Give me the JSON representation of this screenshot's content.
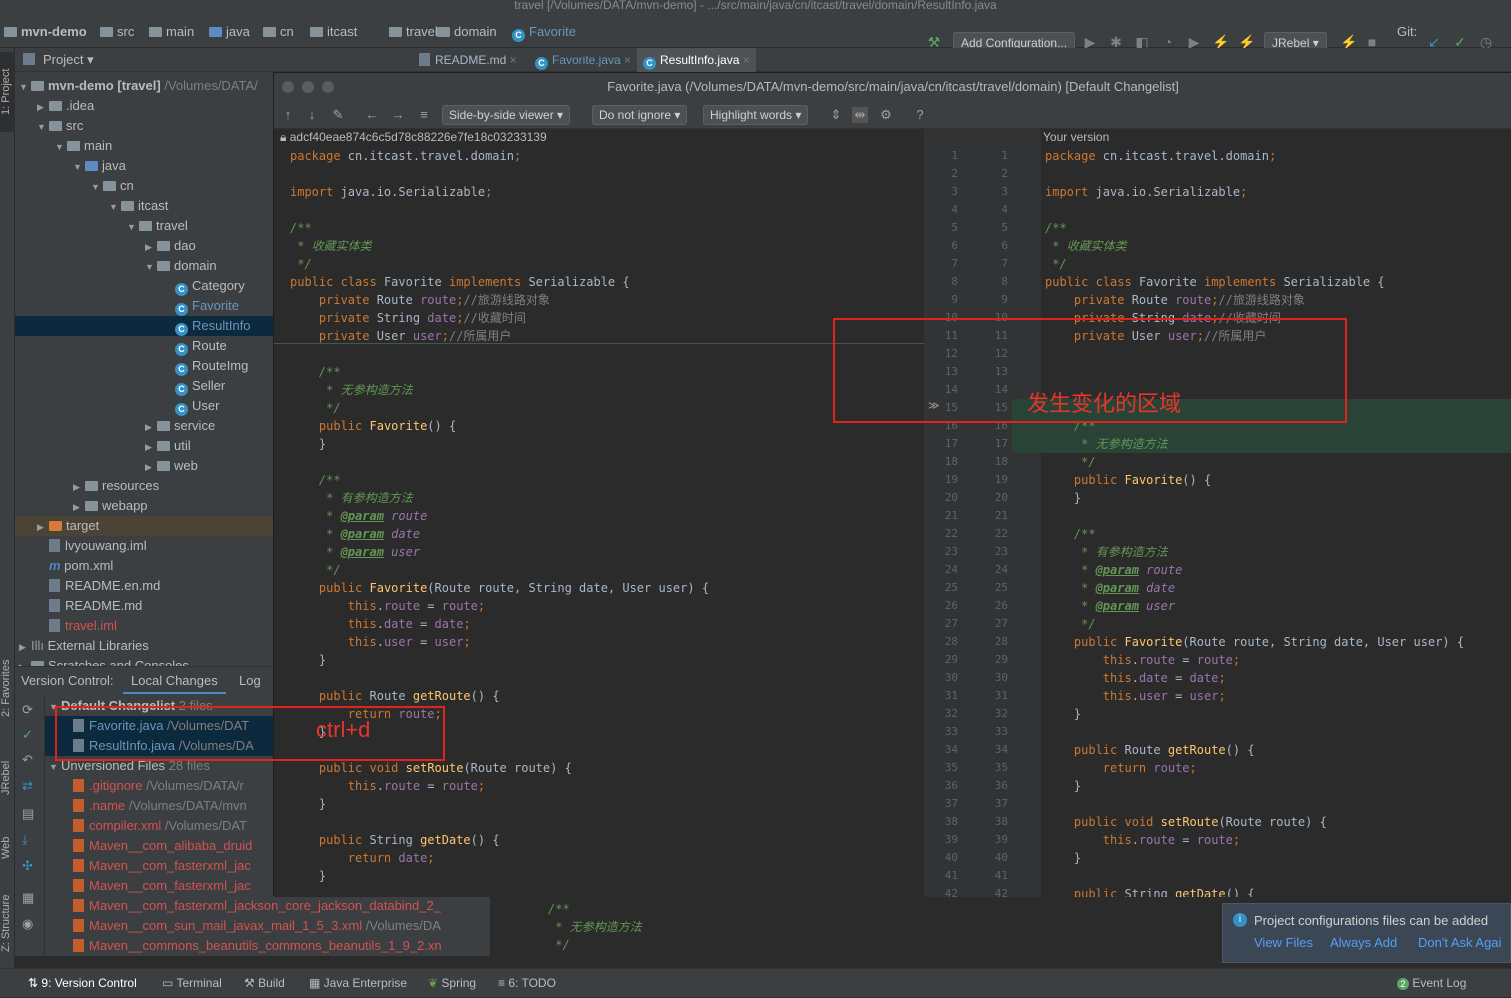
{
  "window": {
    "title": "travel [/Volumes/DATA/mvn-demo] - .../src/main/java/cn/itcast/travel/domain/ResultInfo.java"
  },
  "breadcrumbs": [
    "mvn-demo",
    "src",
    "main",
    "java",
    "cn",
    "itcast",
    "travel",
    "domain",
    "Favorite"
  ],
  "toolbar": {
    "add_config": "Add Configuration...",
    "jrebel": "JRebel",
    "git": "Git:"
  },
  "side_tabs": {
    "project": "1: Project",
    "favorites": "2: Favorites",
    "jrebel": "JRebel",
    "web": "Web",
    "structure": "Z: Structure"
  },
  "project": {
    "title": "Project",
    "tree": [
      {
        "label": "mvn-demo",
        "extra": "[travel]",
        "path": "/Volumes/DATA/",
        "indent": 0,
        "arrow": "▼",
        "type": "folder"
      },
      {
        "label": ".idea",
        "indent": 1,
        "arrow": "▶",
        "type": "folder"
      },
      {
        "label": "src",
        "indent": 1,
        "arrow": "▼",
        "type": "folder"
      },
      {
        "label": "main",
        "indent": 2,
        "arrow": "▼",
        "type": "folder"
      },
      {
        "label": "java",
        "indent": 3,
        "arrow": "▼",
        "type": "bluefolder"
      },
      {
        "label": "cn",
        "indent": 4,
        "arrow": "▼",
        "type": "folder"
      },
      {
        "label": "itcast",
        "indent": 5,
        "arrow": "▼",
        "type": "folder"
      },
      {
        "label": "travel",
        "indent": 6,
        "arrow": "▼",
        "type": "folder"
      },
      {
        "label": "dao",
        "indent": 7,
        "arrow": "▶",
        "type": "folder"
      },
      {
        "label": "domain",
        "indent": 7,
        "arrow": "▼",
        "type": "folder"
      },
      {
        "label": "Category",
        "indent": 8,
        "arrow": "",
        "type": "class"
      },
      {
        "label": "Favorite",
        "indent": 8,
        "arrow": "",
        "type": "class",
        "color": "blue"
      },
      {
        "label": "ResultInfo",
        "indent": 8,
        "arrow": "",
        "type": "class",
        "color": "blue",
        "selected": true
      },
      {
        "label": "Route",
        "indent": 8,
        "arrow": "",
        "type": "class"
      },
      {
        "label": "RouteImg",
        "indent": 8,
        "arrow": "",
        "type": "class"
      },
      {
        "label": "Seller",
        "indent": 8,
        "arrow": "",
        "type": "class"
      },
      {
        "label": "User",
        "indent": 8,
        "arrow": "",
        "type": "class"
      },
      {
        "label": "service",
        "indent": 7,
        "arrow": "▶",
        "type": "folder"
      },
      {
        "label": "util",
        "indent": 7,
        "arrow": "▶",
        "type": "folder"
      },
      {
        "label": "web",
        "indent": 7,
        "arrow": "▶",
        "type": "folder"
      },
      {
        "label": "resources",
        "indent": 3,
        "arrow": "▶",
        "type": "folder"
      },
      {
        "label": "webapp",
        "indent": 3,
        "arrow": "▶",
        "type": "folder"
      },
      {
        "label": "target",
        "indent": 1,
        "arrow": "▶",
        "type": "orangefolder",
        "highlight": true
      },
      {
        "label": "lvyouwang.iml",
        "indent": 1,
        "arrow": "",
        "type": "file"
      },
      {
        "label": "pom.xml",
        "indent": 1,
        "arrow": "",
        "type": "maven"
      },
      {
        "label": "README.en.md",
        "indent": 1,
        "arrow": "",
        "type": "file"
      },
      {
        "label": "README.md",
        "indent": 1,
        "arrow": "",
        "type": "file"
      },
      {
        "label": "travel.iml",
        "indent": 1,
        "arrow": "",
        "type": "file",
        "color": "red"
      },
      {
        "label": "External Libraries",
        "indent": 0,
        "arrow": "▶",
        "type": "lib"
      },
      {
        "label": "Scratches and Consoles",
        "indent": 0,
        "arrow": "▶",
        "type": "folder"
      }
    ]
  },
  "vc": {
    "label": "Version Control:",
    "tabs": [
      "Local Changes",
      "Log"
    ],
    "rows": [
      {
        "text": "Default Changelist",
        "tag": "2 files",
        "indent": 0,
        "arrow": "▼",
        "bold": true
      },
      {
        "text": "Favorite.java",
        "tag": "/Volumes/DAT",
        "indent": 1,
        "color": "blue"
      },
      {
        "text": "ResultInfo.java",
        "tag": "/Volumes/DA",
        "indent": 1,
        "color": "blue"
      },
      {
        "text": "Unversioned Files",
        "tag": "28 files",
        "indent": 0,
        "arrow": "▼"
      },
      {
        "text": ".gitignore",
        "tag": "/Volumes/DATA/r",
        "indent": 1,
        "color": "red"
      },
      {
        "text": ".name",
        "tag": "/Volumes/DATA/mvn",
        "indent": 1,
        "color": "red"
      },
      {
        "text": "compiler.xml",
        "tag": "/Volumes/DAT",
        "indent": 1,
        "color": "red"
      },
      {
        "text": "Maven__com_alibaba_druid",
        "tag": "",
        "indent": 1,
        "color": "red"
      },
      {
        "text": "Maven__com_fasterxml_jac",
        "tag": "",
        "indent": 1,
        "color": "red"
      },
      {
        "text": "Maven__com_fasterxml_jac",
        "tag": "",
        "indent": 1,
        "color": "red"
      },
      {
        "text": "Maven__com_fasterxml_jackson_core_jackson_databind_2_",
        "tag": "",
        "indent": 1,
        "color": "red"
      },
      {
        "text": "Maven__com_sun_mail_javax_mail_1_5_3.xml",
        "tag": "/Volumes/DA",
        "indent": 1,
        "color": "red"
      },
      {
        "text": "Maven__commons_beanutils_commons_beanutils_1_9_2.xn",
        "tag": "",
        "indent": 1,
        "color": "red"
      }
    ]
  },
  "editor_tabs": [
    "README.md",
    "Favorite.java",
    "ResultInfo.java"
  ],
  "diff": {
    "title": "Favorite.java (/Volumes/DATA/mvn-demo/src/main/java/cn/itcast/travel/domain) [Default Changelist]",
    "viewer": "Side-by-side viewer",
    "ignore": "Do not ignore",
    "highlight": "Highlight words",
    "left_header": "adcf40eae874c6c5d78c88226e7fe18c03233139",
    "right_header": "Your version",
    "line_numbers": [
      "1",
      "2",
      "3",
      "4",
      "5",
      "6",
      "7",
      "8",
      "9",
      "10",
      "11",
      "12",
      "13",
      "14",
      "15",
      "16",
      "17",
      "18",
      "19",
      "20",
      "21",
      "22",
      "23",
      "24",
      "25",
      "26",
      "27",
      "28",
      "29",
      "30",
      "31",
      "32",
      "33",
      "34",
      "35",
      "36",
      "37",
      "38",
      "39",
      "40",
      "41",
      "42"
    ],
    "left_lines": [
      "package cn.itcast.travel.domain;",
      "",
      "import java.io.Serializable;",
      "",
      "/**",
      " * 收藏实体类",
      " */",
      "public class Favorite implements Serializable {",
      "    private Route route;//旅游线路对象",
      "    private String date;//收藏时间",
      "    private User user;//所属用户",
      "",
      "    /**",
      "     * 无参构造方法",
      "     */",
      "    public Favorite() {",
      "    }",
      "",
      "    /**",
      "     * 有参构造方法",
      "     * @param route",
      "     * @param date",
      "     * @param user",
      "     */",
      "    public Favorite(Route route, String date, User user) {",
      "        this.route = route;",
      "        this.date = date;",
      "        this.user = user;",
      "    }",
      "",
      "    public Route getRoute() {",
      "        return route;",
      "    }",
      "",
      "    public void setRoute(Route route) {",
      "        this.route = route;",
      "    }",
      "",
      "    public String getDate() {",
      "        return date;",
      "    }"
    ],
    "right_lines": [
      "package cn.itcast.travel.domain;",
      "",
      "import java.io.Serializable;",
      "",
      "/**",
      " * 收藏实体类",
      " */",
      "public class Favorite implements Serializable {",
      "    private Route route;//旅游线路对象",
      "    private String date;//收藏时间",
      "    private User user;//所属用户",
      "",
      "",
      "",
      "",
      "    /**",
      "     * 无参构造方法",
      "     */",
      "    public Favorite() {",
      "    }",
      "",
      "    /**",
      "     * 有参构造方法",
      "     * @param route",
      "     * @param date",
      "     * @param user",
      "     */",
      "    public Favorite(Route route, String date, User user) {",
      "        this.route = route;",
      "        this.date = date;",
      "        this.user = user;",
      "    }",
      "",
      "    public Route getRoute() {",
      "        return route;",
      "    }",
      "",
      "    public void setRoute(Route route) {",
      "        this.route = route;",
      "    }",
      "",
      "    public String getDate() {"
    ]
  },
  "annotations": {
    "changed_region": "发生变化的区域",
    "shortcut": "ctrl+d"
  },
  "background_code": [
    "/**",
    " * 无参构造方法",
    " */"
  ],
  "notification": {
    "text": "Project configurations files can be added",
    "view": "View Files",
    "always": "Always Add",
    "dont": "Don't Ask Agai"
  },
  "statusbar": {
    "vc": "9: Version Control",
    "terminal": "Terminal",
    "build": "Build",
    "javaee": "Java Enterprise",
    "spring": "Spring",
    "todo": "6: TODO",
    "eventlog": "Event Log",
    "eventcount": "2"
  }
}
